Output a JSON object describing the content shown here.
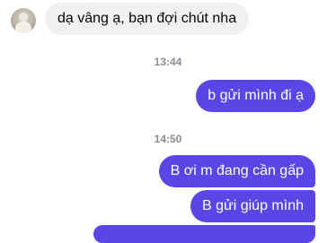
{
  "messages": {
    "incoming_1": "dạ vâng ạ, bạn đợi chút nha",
    "timestamp_1": "13:44",
    "outgoing_1": "b gửi mình đi ạ",
    "timestamp_2": "14:50",
    "outgoing_2": "B ơi m đang cần gấp",
    "outgoing_3": "B gửi giúp mình"
  },
  "colors": {
    "outgoing_bubble": "#5a45e6",
    "incoming_bubble": "#f0f0f0",
    "timestamp_text": "#8a8d91"
  },
  "icons": {
    "avatar": "contact-avatar"
  }
}
